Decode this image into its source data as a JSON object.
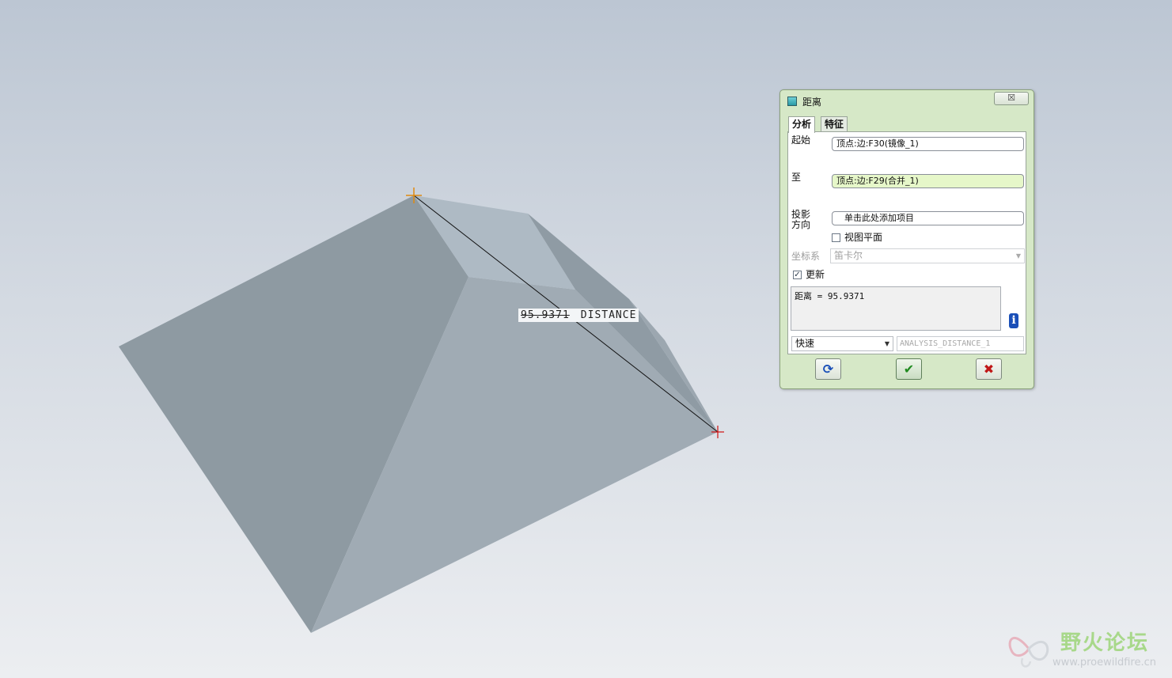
{
  "viewport": {
    "dimension_value": "95.9371",
    "dimension_name": "DISTANCE"
  },
  "dialog": {
    "title": "距离",
    "close_glyph": "☒",
    "tabs": [
      {
        "label": "分析",
        "active": true
      },
      {
        "label": "特征",
        "active": false
      }
    ],
    "from_label": "起始",
    "from_value": "顶点:边:F30(镜像_1)",
    "to_label": "至",
    "to_value": "顶点:边:F29(合并_1)",
    "projection_label_line1": "投影",
    "projection_label_line2": "方向",
    "projection_placeholder": "单击此处添加项目",
    "view_plane_label": "视图平面",
    "view_plane_checked": false,
    "csys_label": "坐标系",
    "csys_value": "笛卡尔",
    "update_label": "更新",
    "update_checked": true,
    "result_text": "距离  = 95.9371",
    "info_glyph": "i",
    "mode_value": "快速",
    "feature_name": "ANALYSIS_DISTANCE_1",
    "buttons": {
      "repeat_glyph": "⟳",
      "ok_glyph": "✔",
      "cancel_glyph": "✖"
    }
  },
  "watermark": {
    "title": "野火论坛",
    "url": "www.proewildfire.cn"
  },
  "colors": {
    "accent_green": "#d6e8c7",
    "ok_green": "#1f8a1f",
    "cancel_red": "#c01818",
    "repeat_blue": "#1a4fb8"
  }
}
